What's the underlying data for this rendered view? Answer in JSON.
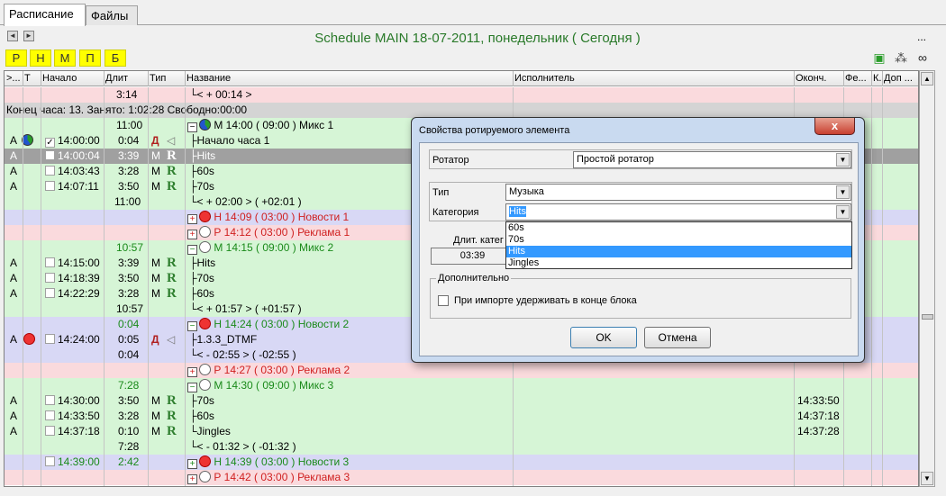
{
  "tabs": [
    {
      "label": "Расписание"
    },
    {
      "label": "Файлы"
    }
  ],
  "header": {
    "title": "Schedule MAIN 18-07-2011, понедельник ( Сегодня )",
    "nav_prev": "◄",
    "nav_next": "►",
    "more": "..."
  },
  "filter_buttons": [
    "Р",
    "Н",
    "М",
    "П",
    "Б"
  ],
  "columns": {
    "c0": ">...",
    "c1": "Т",
    "c2": "Начало",
    "c3": "Длит",
    "c4": "Тип",
    "c5": "Название",
    "c6": "Исполнитель",
    "c7": "Оконч.",
    "c8": "Фе...",
    "c9": "К.",
    "c10": "Доп ..."
  },
  "rows": {
    "r0": {
      "dur": "3:14",
      "name": "└< + 00:14 >"
    },
    "r1": {
      "text": "Конец часа: 13. Занято: 1:02:28 Свободно:00:00"
    },
    "r2": {
      "dur": "11:00",
      "pm": "−",
      "name": "М 14:00 ( 09:00 ) Микс 1"
    },
    "r3": {
      "t": "А",
      "start": "14:00:00",
      "dur": "0:04",
      "type": "Д",
      "name": "Начало часа 1"
    },
    "r4": {
      "t": "А",
      "start": "14:00:04",
      "dur": "3:39",
      "type": "М",
      "r": "R",
      "name": "Hits"
    },
    "r5": {
      "t": "А",
      "start": "14:03:43",
      "dur": "3:28",
      "type": "М",
      "r": "R",
      "name": "60s"
    },
    "r6": {
      "t": "А",
      "start": "14:07:11",
      "dur": "3:50",
      "type": "М",
      "r": "R",
      "name": "70s"
    },
    "r7": {
      "dur": "11:00",
      "name": "└< + 02:00 > ( +02:01 )"
    },
    "r8": {
      "pm": "+",
      "name": "Н 14:09 ( 03:00 ) Новости 1"
    },
    "r9": {
      "pm": "+",
      "name": "Р 14:12 ( 03:00 ) Реклама 1"
    },
    "r10": {
      "dur": "10:57",
      "pm": "−",
      "name": "М 14:15 ( 09:00 ) Микс 2"
    },
    "r11": {
      "t": "А",
      "start": "14:15:00",
      "dur": "3:39",
      "type": "М",
      "r": "R",
      "name": "Hits"
    },
    "r12": {
      "t": "А",
      "start": "14:18:39",
      "dur": "3:50",
      "type": "М",
      "r": "R",
      "name": "70s"
    },
    "r13": {
      "t": "А",
      "start": "14:22:29",
      "dur": "3:28",
      "type": "М",
      "r": "R",
      "name": "60s"
    },
    "r14": {
      "dur": "10:57",
      "name": "└< + 01:57 > ( +01:57 )"
    },
    "r15": {
      "dur": "0:04",
      "pm": "−",
      "name": "Н 14:24 ( 03:00 ) Новости 2"
    },
    "r16": {
      "t": "А",
      "start": "14:24:00",
      "dur": "0:05",
      "type": "Д",
      "name": "1.3.3_DTMF"
    },
    "r17": {
      "dur": "0:04",
      "name": "└< - 02:55 > ( -02:55 )"
    },
    "r18": {
      "pm": "+",
      "name": "Р 14:27 ( 03:00 ) Реклама 2"
    },
    "r19": {
      "dur": "7:28",
      "pm": "−",
      "name": "М 14:30 ( 09:00 ) Микс 3"
    },
    "r20": {
      "t": "А",
      "start": "14:30:00",
      "dur": "3:50",
      "type": "М",
      "r": "R",
      "name": "70s",
      "end": "14:33:50"
    },
    "r21": {
      "t": "А",
      "start": "14:33:50",
      "dur": "3:28",
      "type": "М",
      "r": "R",
      "name": "60s",
      "end": "14:37:18"
    },
    "r22": {
      "t": "А",
      "start": "14:37:18",
      "dur": "0:10",
      "type": "М",
      "r": "R",
      "name": "Jingles",
      "end": "14:37:28"
    },
    "r23": {
      "dur": "7:28",
      "name": "└< - 01:32 > ( -01:32 )"
    },
    "r24": {
      "start": "14:39:00",
      "dur": "2:42",
      "pm": "+",
      "name": "Н 14:39 ( 03:00 ) Новости 3"
    },
    "r25": {
      "pm": "+",
      "name": "Р 14:42 ( 03:00 ) Реклама 3"
    }
  },
  "dialog": {
    "title": "Свойства ротируемого элемента",
    "close": "x",
    "rotator_label": "Ротатор",
    "rotator_value": "Простой ротатор",
    "type_label": "Тип",
    "type_value": "Музыка",
    "category_label": "Категория",
    "category_value": "Hits",
    "category_options": [
      "60s",
      "70s",
      "Hits",
      "Jingles"
    ],
    "duration_label": "Длит. катег",
    "duration_value": "03:39",
    "extra_group": "Дополнительно",
    "checkbox_label": "При импорте удерживать в конце блока",
    "ok": "OK",
    "cancel": "Отмена"
  },
  "colors": {
    "green_row": "#d6f5d6",
    "pink_row": "#fadadd",
    "blue_row": "#d8d8f5",
    "accent": "#2a7a2a",
    "filter": "#ffff00"
  }
}
